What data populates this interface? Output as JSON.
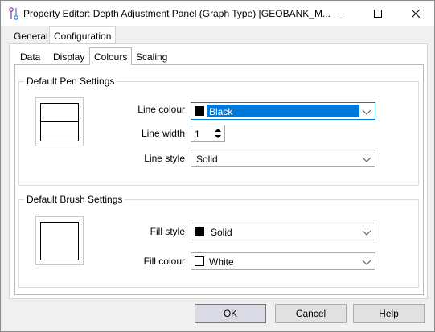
{
  "window": {
    "title": "Property Editor: Depth Adjustment Panel (Graph Type) [GEOBANK_M...",
    "icon": "property-editor-icon"
  },
  "outer_tabs": [
    {
      "label": "General",
      "selected": false
    },
    {
      "label": "Configuration",
      "selected": true
    }
  ],
  "inner_tabs": [
    {
      "label": "Data",
      "selected": false
    },
    {
      "label": "Display",
      "selected": false
    },
    {
      "label": "Colours",
      "selected": true
    },
    {
      "label": "Scaling",
      "selected": false
    }
  ],
  "pen_group": {
    "title": "Default Pen Settings",
    "line_colour": {
      "label": "Line colour",
      "value": "Black",
      "swatch": "#000000"
    },
    "line_width": {
      "label": "Line width",
      "value": "1"
    },
    "line_style": {
      "label": "Line style",
      "value": "Solid"
    }
  },
  "brush_group": {
    "title": "Default Brush Settings",
    "fill_style": {
      "label": "Fill style",
      "value": "Solid",
      "swatch": "#000000"
    },
    "fill_colour": {
      "label": "Fill colour",
      "value": "White",
      "swatch": "#ffffff"
    }
  },
  "buttons": {
    "ok": "OK",
    "cancel": "Cancel",
    "help": "Help"
  },
  "colors": {
    "accent": "#0078d7"
  }
}
